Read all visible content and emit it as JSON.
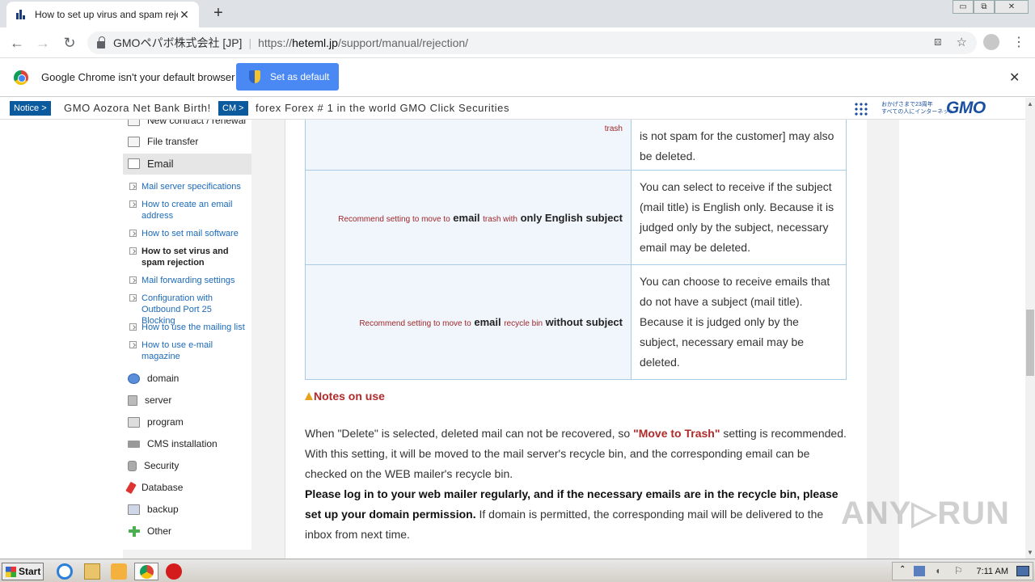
{
  "browser": {
    "tab_title": "How to set up virus and spam rejection",
    "tab_close": "✕",
    "new_tab": "+",
    "window_controls": [
      "▭",
      "⧉",
      "✕"
    ],
    "site_identity": "GMOペパボ株式会社 [JP]",
    "url": {
      "protocol": "https://",
      "host": "heteml.jp",
      "path": "/support/manual/rejection/"
    },
    "nav": {
      "back": "←",
      "forward": "→",
      "reload": "↻"
    },
    "omni_icons": {
      "translate": "⧈",
      "star": "☆"
    },
    "menu": "⋮"
  },
  "infobar": {
    "message": "Google Chrome isn't your default browser",
    "button": "Set as default",
    "close": "✕"
  },
  "ticker": {
    "notice_badge": "Notice >",
    "notice_text": "GMO Aozora Net Bank Birth!",
    "cm_badge": "CM >",
    "cm_text": "forex Forex # 1 in the world GMO Click Securities",
    "gmo_tagline_1": "おかげさまで23周年",
    "gmo_tagline_2": "すべての人にインターネット",
    "gmo_logo": "GMO"
  },
  "sidebar": {
    "top_items": [
      "New contract / renewal",
      "File transfer",
      "Email"
    ],
    "email_sub": [
      "Mail server specifications",
      "How to create an email address",
      "How to set mail software",
      "How to set virus and spam rejection",
      "Mail forwarding settings",
      "Configuration with Outbound Port 25 Blocking",
      "How to use the mailing list",
      "How to use e-mail magazine"
    ],
    "bottom_items": [
      "domain",
      "server",
      "program",
      "CMS installation",
      "Security",
      "Database",
      "backup",
      "Other"
    ]
  },
  "table": {
    "row1": {
      "label_small": "trash",
      "desc": "is not spam for the customer] may also be deleted."
    },
    "row2": {
      "pre": "Recommend setting to move to",
      "email": "email",
      "mid": "trash with",
      "bold": "only English subject",
      "desc": "You can select to receive if the subject (mail title) is English only. Because it is judged only by the subject, necessary email may be deleted."
    },
    "row3": {
      "pre": "Recommend setting to move to",
      "email": "email",
      "mid": "recycle bin",
      "bold": "without subject",
      "desc": "You can choose to receive emails that do not have a subject (mail title). Because it is judged only by the subject, necessary email may be deleted."
    }
  },
  "notes": {
    "heading": "Notes on use",
    "p1_a": "When \"Delete\" is selected, deleted mail can not be recovered, so",
    "p1_red": "\"Move to Trash\"",
    "p1_b": "setting is recommended. With this setting, it will be moved to the mail server's recycle bin, and the corresponding email can be checked on the WEB mailer's recycle bin.",
    "p2_bold": "Please log in to your web mailer regularly, and if the necessary emails are in the recycle bin, please set up your domain permission.",
    "p2_rest": "If domain is permitted, the corresponding mail will be delivered to the inbox from next time."
  },
  "watermark": "ANY▷RUN",
  "taskbar": {
    "start": "Start",
    "clock": "7:11 AM"
  }
}
